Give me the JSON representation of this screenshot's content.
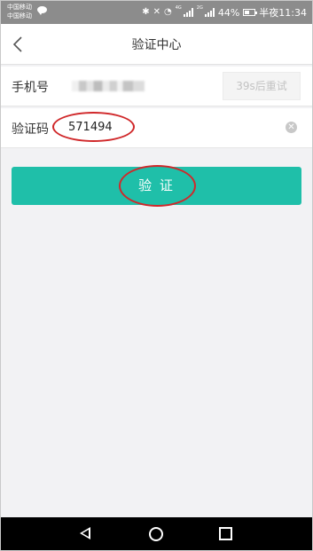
{
  "status_bar": {
    "carrier_1": "中国移动",
    "carrier_2": "中国移动",
    "network_1": "4G",
    "network_2": "2G",
    "battery": "44%",
    "time": "半夜11:34"
  },
  "header": {
    "title": "验证中心"
  },
  "form": {
    "phone_label": "手机号",
    "resend_button": "39s后重试",
    "code_label": "验证码",
    "code_value": "571494",
    "clear_icon": "clear-icon"
  },
  "actions": {
    "verify_button": "验 证"
  },
  "colors": {
    "accent": "#1fbfa9",
    "status_bar": "#8c8c8c",
    "annotation": "#d0282a"
  }
}
